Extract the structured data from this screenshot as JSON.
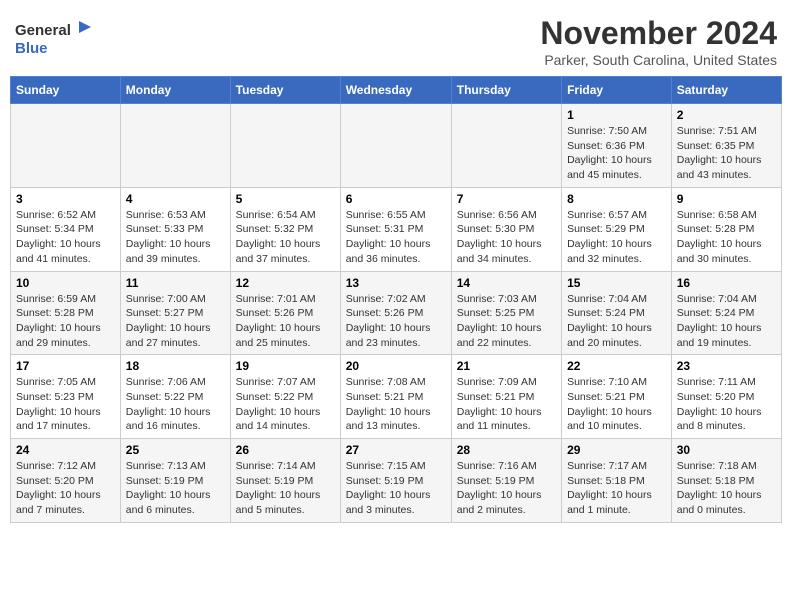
{
  "header": {
    "logo_general": "General",
    "logo_blue": "Blue",
    "month_year": "November 2024",
    "location": "Parker, South Carolina, United States"
  },
  "days_of_week": [
    "Sunday",
    "Monday",
    "Tuesday",
    "Wednesday",
    "Thursday",
    "Friday",
    "Saturday"
  ],
  "weeks": [
    {
      "days": [
        {
          "num": "",
          "info": ""
        },
        {
          "num": "",
          "info": ""
        },
        {
          "num": "",
          "info": ""
        },
        {
          "num": "",
          "info": ""
        },
        {
          "num": "",
          "info": ""
        },
        {
          "num": "1",
          "info": "Sunrise: 7:50 AM\nSunset: 6:36 PM\nDaylight: 10 hours and 45 minutes."
        },
        {
          "num": "2",
          "info": "Sunrise: 7:51 AM\nSunset: 6:35 PM\nDaylight: 10 hours and 43 minutes."
        }
      ]
    },
    {
      "days": [
        {
          "num": "3",
          "info": "Sunrise: 6:52 AM\nSunset: 5:34 PM\nDaylight: 10 hours and 41 minutes."
        },
        {
          "num": "4",
          "info": "Sunrise: 6:53 AM\nSunset: 5:33 PM\nDaylight: 10 hours and 39 minutes."
        },
        {
          "num": "5",
          "info": "Sunrise: 6:54 AM\nSunset: 5:32 PM\nDaylight: 10 hours and 37 minutes."
        },
        {
          "num": "6",
          "info": "Sunrise: 6:55 AM\nSunset: 5:31 PM\nDaylight: 10 hours and 36 minutes."
        },
        {
          "num": "7",
          "info": "Sunrise: 6:56 AM\nSunset: 5:30 PM\nDaylight: 10 hours and 34 minutes."
        },
        {
          "num": "8",
          "info": "Sunrise: 6:57 AM\nSunset: 5:29 PM\nDaylight: 10 hours and 32 minutes."
        },
        {
          "num": "9",
          "info": "Sunrise: 6:58 AM\nSunset: 5:28 PM\nDaylight: 10 hours and 30 minutes."
        }
      ]
    },
    {
      "days": [
        {
          "num": "10",
          "info": "Sunrise: 6:59 AM\nSunset: 5:28 PM\nDaylight: 10 hours and 29 minutes."
        },
        {
          "num": "11",
          "info": "Sunrise: 7:00 AM\nSunset: 5:27 PM\nDaylight: 10 hours and 27 minutes."
        },
        {
          "num": "12",
          "info": "Sunrise: 7:01 AM\nSunset: 5:26 PM\nDaylight: 10 hours and 25 minutes."
        },
        {
          "num": "13",
          "info": "Sunrise: 7:02 AM\nSunset: 5:26 PM\nDaylight: 10 hours and 23 minutes."
        },
        {
          "num": "14",
          "info": "Sunrise: 7:03 AM\nSunset: 5:25 PM\nDaylight: 10 hours and 22 minutes."
        },
        {
          "num": "15",
          "info": "Sunrise: 7:04 AM\nSunset: 5:24 PM\nDaylight: 10 hours and 20 minutes."
        },
        {
          "num": "16",
          "info": "Sunrise: 7:04 AM\nSunset: 5:24 PM\nDaylight: 10 hours and 19 minutes."
        }
      ]
    },
    {
      "days": [
        {
          "num": "17",
          "info": "Sunrise: 7:05 AM\nSunset: 5:23 PM\nDaylight: 10 hours and 17 minutes."
        },
        {
          "num": "18",
          "info": "Sunrise: 7:06 AM\nSunset: 5:22 PM\nDaylight: 10 hours and 16 minutes."
        },
        {
          "num": "19",
          "info": "Sunrise: 7:07 AM\nSunset: 5:22 PM\nDaylight: 10 hours and 14 minutes."
        },
        {
          "num": "20",
          "info": "Sunrise: 7:08 AM\nSunset: 5:21 PM\nDaylight: 10 hours and 13 minutes."
        },
        {
          "num": "21",
          "info": "Sunrise: 7:09 AM\nSunset: 5:21 PM\nDaylight: 10 hours and 11 minutes."
        },
        {
          "num": "22",
          "info": "Sunrise: 7:10 AM\nSunset: 5:21 PM\nDaylight: 10 hours and 10 minutes."
        },
        {
          "num": "23",
          "info": "Sunrise: 7:11 AM\nSunset: 5:20 PM\nDaylight: 10 hours and 8 minutes."
        }
      ]
    },
    {
      "days": [
        {
          "num": "24",
          "info": "Sunrise: 7:12 AM\nSunset: 5:20 PM\nDaylight: 10 hours and 7 minutes."
        },
        {
          "num": "25",
          "info": "Sunrise: 7:13 AM\nSunset: 5:19 PM\nDaylight: 10 hours and 6 minutes."
        },
        {
          "num": "26",
          "info": "Sunrise: 7:14 AM\nSunset: 5:19 PM\nDaylight: 10 hours and 5 minutes."
        },
        {
          "num": "27",
          "info": "Sunrise: 7:15 AM\nSunset: 5:19 PM\nDaylight: 10 hours and 3 minutes."
        },
        {
          "num": "28",
          "info": "Sunrise: 7:16 AM\nSunset: 5:19 PM\nDaylight: 10 hours and 2 minutes."
        },
        {
          "num": "29",
          "info": "Sunrise: 7:17 AM\nSunset: 5:18 PM\nDaylight: 10 hours and 1 minute."
        },
        {
          "num": "30",
          "info": "Sunrise: 7:18 AM\nSunset: 5:18 PM\nDaylight: 10 hours and 0 minutes."
        }
      ]
    }
  ]
}
